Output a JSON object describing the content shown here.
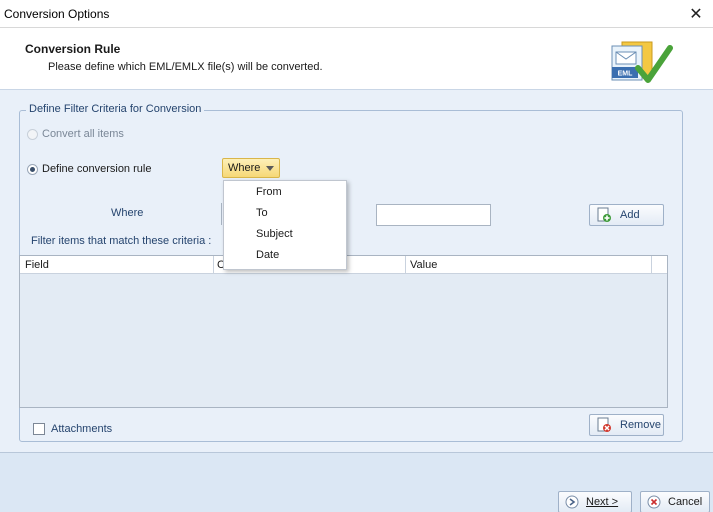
{
  "window": {
    "title": "Conversion Options",
    "close_glyph": "✕"
  },
  "banner": {
    "heading": "Conversion Rule",
    "subtitle": "Please define which EML/EMLX file(s) will be converted.",
    "logo_icon": "eml-file-check-icon",
    "logo_badge": "EML"
  },
  "filter_group": {
    "legend": "Define Filter Criteria for Conversion",
    "option_all": "Convert all items",
    "option_rule": "Define conversion rule",
    "selected_option": "Define conversion rule",
    "where_dropdown": {
      "selected": "Where",
      "options": [
        "From",
        "To",
        "Subject",
        "Date"
      ]
    },
    "where_label": "Where",
    "value_input": "",
    "add_button": "Add",
    "criteria_label": "Filter items that match these criteria :",
    "grid_columns": [
      "Field",
      "C",
      "Value"
    ],
    "attachments_label": "Attachments",
    "attachments_checked": false,
    "remove_button": "Remove"
  },
  "footer": {
    "next_button": "Next >",
    "cancel_button": "Cancel"
  },
  "colors": {
    "accent_yellow": "#f6d877",
    "panel": "#e9f0f9",
    "border": "#a9bdd6"
  }
}
